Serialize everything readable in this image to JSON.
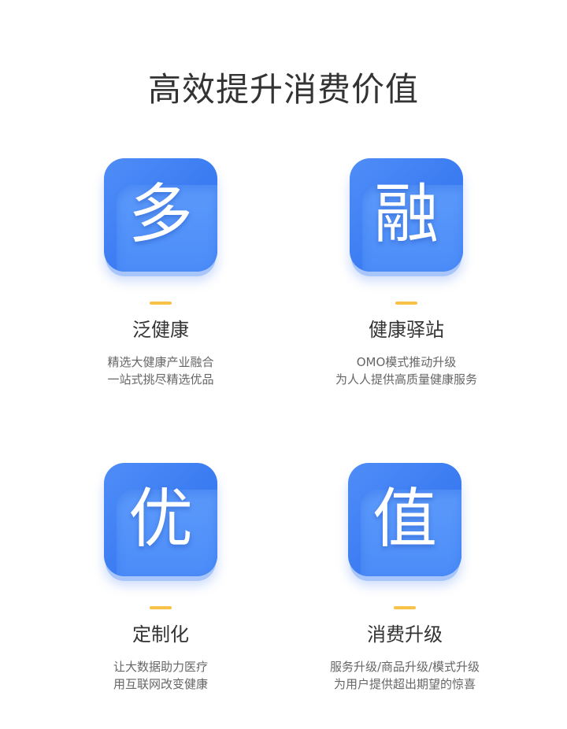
{
  "header": {
    "title": "高效提升消费价值"
  },
  "features": [
    {
      "glyph": "多",
      "title": "泛健康",
      "desc": [
        "精选大健康产业融合",
        "一站式挑尽精选优品"
      ]
    },
    {
      "glyph": "融",
      "title": "健康驿站",
      "desc": [
        "OMO模式推动升级",
        "为人人提供高质量健康服务"
      ]
    },
    {
      "glyph": "优",
      "title": "定制化",
      "desc": [
        "让大数据助力医疗",
        "用互联网改变健康"
      ]
    },
    {
      "glyph": "值",
      "title": "消费升级",
      "desc": [
        "服务升级/商品升级/模式升级",
        "为用户提供超出期望的惊喜"
      ]
    }
  ],
  "colors": {
    "tile_blue": "#3b7cf2",
    "accent_yellow": "#f7c14a",
    "title_text": "#333333",
    "desc_text": "#666666"
  }
}
